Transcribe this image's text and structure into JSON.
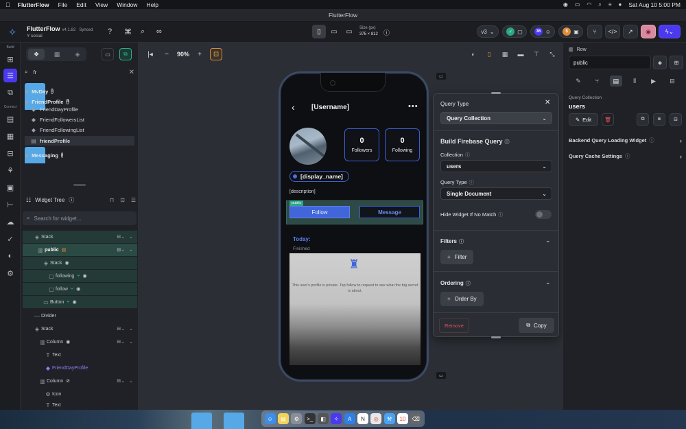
{
  "menubar": {
    "app": "FlutterFlow",
    "items": [
      "File",
      "Edit",
      "View",
      "Window",
      "Help"
    ],
    "datetime": "Sat Aug 10  5:00 PM"
  },
  "window": {
    "title": "FlutterFlow"
  },
  "header": {
    "brand": "FlutterFlow",
    "version": "v4.1.82",
    "sync": "Synced",
    "project": "Y social",
    "size_label": "Size (px)",
    "size_value": "375 × 812",
    "branch": "v3",
    "count_badge": "36"
  },
  "rail": {
    "build_label": "Build",
    "connect_label": "Connect"
  },
  "pages": {
    "search_value": "fr",
    "items": [
      {
        "label": "MyDay",
        "type": "folder"
      },
      {
        "label": "FriendProfile",
        "type": "folder"
      },
      {
        "label": "FriendDayProfile",
        "type": "page"
      },
      {
        "label": "FriendFollowersList",
        "type": "page"
      },
      {
        "label": "FriendFollowingList",
        "type": "page"
      },
      {
        "label": "friendProfile",
        "type": "page",
        "selected": true
      },
      {
        "label": "Messaging",
        "type": "folder"
      }
    ]
  },
  "widget_tree": {
    "title": "Widget Tree",
    "search_placeholder": "Search for widget...",
    "nodes": [
      {
        "label": "Stack",
        "indent": 1
      },
      {
        "label": "public",
        "indent": 1,
        "selected": true
      },
      {
        "label": "Stack",
        "indent": 2
      },
      {
        "label": "following",
        "indent": 3
      },
      {
        "label": "follow",
        "indent": 3
      },
      {
        "label": "Button",
        "indent": 2
      },
      {
        "label": "Divider",
        "indent": 0
      },
      {
        "label": "Stack",
        "indent": 0
      },
      {
        "label": "Column",
        "indent": 1
      },
      {
        "label": "Text",
        "indent": 2
      },
      {
        "label": "FriendDayProfile",
        "indent": 2
      },
      {
        "label": "Column",
        "indent": 1
      },
      {
        "label": "Icon",
        "indent": 2
      },
      {
        "label": "Text",
        "indent": 2
      }
    ]
  },
  "canvas": {
    "zoom": "90%"
  },
  "phone": {
    "title": "[Username]",
    "followers_count": "0",
    "followers_label": "Followers",
    "following_count": "0",
    "following_label": "Following",
    "display_name": "[display_name]",
    "description": "[description]",
    "selected_tag": "public",
    "follow_label": "Follow",
    "message_label": "Message",
    "today_label": "Today:",
    "finished_label": "Finished",
    "private_text": "This user's profile is private. Tap follow to request to see what the big secret is about."
  },
  "query_popover": {
    "query_type_label": "Query Type",
    "query_type_value": "Query Collection",
    "section_title": "Build Firebase Query",
    "collection_label": "Collection",
    "collection_value": "users",
    "query_type2_label": "Query Type",
    "query_type2_value": "Single Document",
    "hide_label": "Hide Widget If No Match",
    "filters_label": "Filters",
    "filter_btn": "Filter",
    "ordering_label": "Ordering",
    "orderby_btn": "Order By",
    "remove_label": "Remove",
    "copy_label": "Copy"
  },
  "properties": {
    "widget_type": "Row",
    "widget_name": "public",
    "query_collection_label": "Query Collection",
    "query_collection_value": "users",
    "edit_label": "Edit",
    "backend_widget_label": "Backend Query Loading Widget",
    "cache_label": "Query Cache Settings"
  }
}
